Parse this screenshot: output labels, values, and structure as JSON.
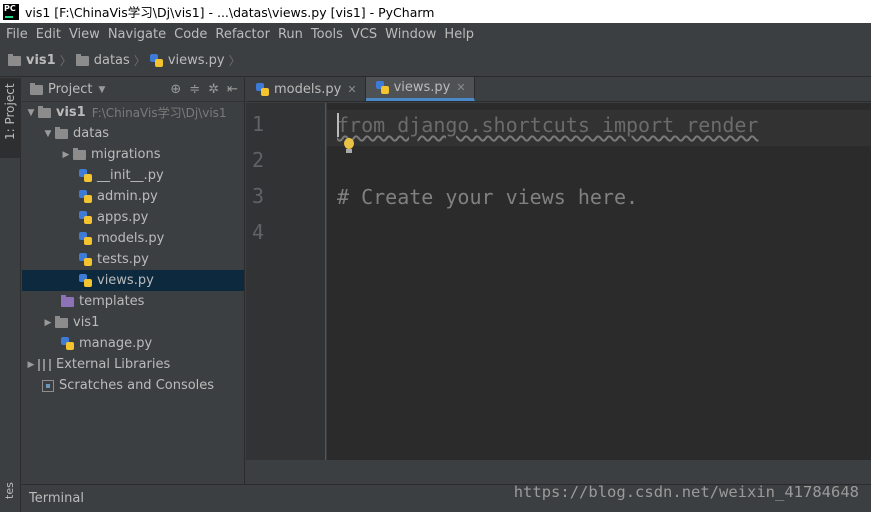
{
  "window": {
    "title": "vis1 [F:\\ChinaVis学习\\Dj\\vis1] - ...\\datas\\views.py [vis1] - PyCharm"
  },
  "menu": [
    "File",
    "Edit",
    "View",
    "Navigate",
    "Code",
    "Refactor",
    "Run",
    "Tools",
    "VCS",
    "Window",
    "Help"
  ],
  "breadcrumb": [
    "vis1",
    "datas",
    "views.py"
  ],
  "sidebar": {
    "project_tab": "1: Project",
    "structure_tab": "tes"
  },
  "project_panel": {
    "header": "Project",
    "root": {
      "name": "vis1",
      "path": "F:\\ChinaVis学习\\Dj\\vis1"
    },
    "datas": "datas",
    "migrations": "migrations",
    "files": [
      "__init__.py",
      "admin.py",
      "apps.py",
      "models.py",
      "tests.py",
      "views.py"
    ],
    "templates": "templates",
    "vis1_folder": "vis1",
    "manage": "manage.py",
    "external": "External Libraries",
    "scratches": "Scratches and Consoles"
  },
  "tabs": [
    {
      "label": "models.py",
      "active": false
    },
    {
      "label": "views.py",
      "active": true
    }
  ],
  "editor": {
    "line_numbers": [
      "1",
      "2",
      "3",
      "4"
    ],
    "line1": "from django.shortcuts import render",
    "line3": "# Create your views here."
  },
  "bottom": {
    "terminal": "Terminal"
  },
  "watermark": "https://blog.csdn.net/weixin_41784648",
  "colors": {
    "accent": "#4a88c7",
    "selection": "#0d293e",
    "editor_bg": "#2b2b2b",
    "panel_bg": "#3c3f41"
  }
}
